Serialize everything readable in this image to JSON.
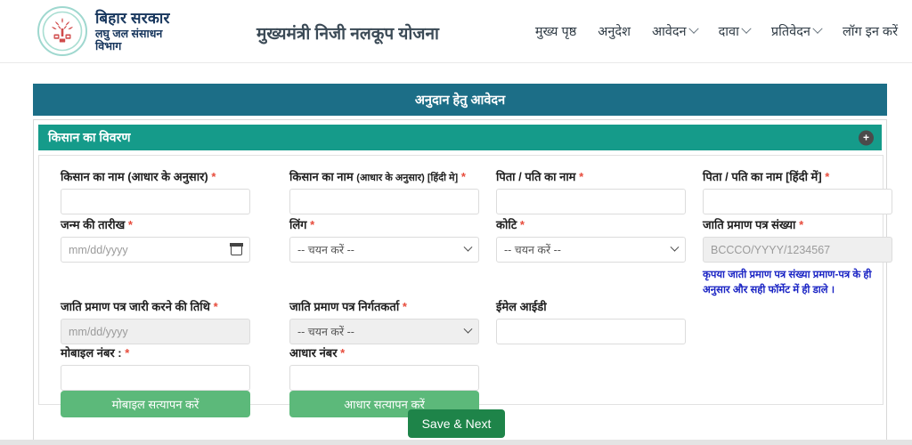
{
  "header": {
    "brand": {
      "line1": "बिहार सरकार",
      "line2": "लघु जल संसाधन",
      "line3": "विभाग",
      "emblem_icon": "bihar-emblem-icon"
    },
    "site_title": "मुख्यमंत्री निजी नलकूप योजना",
    "nav": [
      {
        "label": "मुख्य पृष्ठ",
        "has_caret": false
      },
      {
        "label": "अनुदेश",
        "has_caret": false
      },
      {
        "label": "आवेदन",
        "has_caret": true
      },
      {
        "label": "दावा",
        "has_caret": true
      },
      {
        "label": "प्रतिवेदन",
        "has_caret": true
      },
      {
        "label": "लॉग इन करें",
        "has_caret": false
      }
    ]
  },
  "banner": {
    "title": "अनुदान हेतु आवेदन"
  },
  "section": {
    "title": "किसान का विवरण",
    "toggle_icon": "plus-icon"
  },
  "form": {
    "farmer_name": {
      "label": "किसान का नाम (आधार के अनुसार)",
      "required": true,
      "value": "",
      "placeholder": ""
    },
    "farmer_name_hi": {
      "label_main": "किसान का नाम",
      "label_small": "(आधार के अनुसार) [हिंदी मे]",
      "required": true,
      "value": "",
      "placeholder": ""
    },
    "father_name": {
      "label": "पिता / पति का नाम",
      "required": true,
      "value": "",
      "placeholder": ""
    },
    "father_name_hi": {
      "label": "पिता / पति का नाम [हिंदी में]",
      "required": true,
      "value": "",
      "placeholder": ""
    },
    "dob": {
      "label": "जन्म की तारीख",
      "required": true,
      "value": "",
      "placeholder": "mm/dd/yyyy",
      "icon": "calendar-icon"
    },
    "gender": {
      "label": "लिंग",
      "required": true,
      "selected": "-- चयन करें --"
    },
    "category": {
      "label": "कोटि",
      "required": true,
      "selected": "-- चयन करें --"
    },
    "caste_cert_no": {
      "label": "जाति प्रमाण पत्र संख्या",
      "required": true,
      "value": "",
      "placeholder": "BCCCO/YYYY/1234567",
      "note": "कृपया जाती प्रमाण पत्र संख्या प्रमाण-पत्र के ही अनुसार और सही फॉर्मेट में ही डाले ।"
    },
    "caste_cert_date": {
      "label": "जाति प्रमाण पत्र जारी करने की तिथि",
      "required": true,
      "value": "",
      "placeholder": "mm/dd/yyyy"
    },
    "caste_cert_issuer": {
      "label": "जाति प्रमाण पत्र निर्गतकर्ता",
      "required": true,
      "selected": "-- चयन करें --"
    },
    "email": {
      "label": "ईमेल आईडी",
      "required": false,
      "value": "",
      "placeholder": ""
    },
    "mobile": {
      "label": "मोबाइल नंबर :",
      "required": true,
      "value": "",
      "placeholder": ""
    },
    "aadhaar": {
      "label": "आधार नंबर",
      "required": true,
      "value": "",
      "placeholder": ""
    },
    "verify_mobile_button": "मोबाइल सत्यापन करें",
    "verify_aadhaar_button": "आधार सत्यापन करें",
    "save_button": "Save & Next"
  },
  "colors": {
    "banner_bg": "#1c6e87",
    "section_bg": "#159b8a",
    "verify_btn": "#5cb97a",
    "save_btn": "#1e8449",
    "required_star": "#e74c3c",
    "note_text": "#1a24c4"
  }
}
